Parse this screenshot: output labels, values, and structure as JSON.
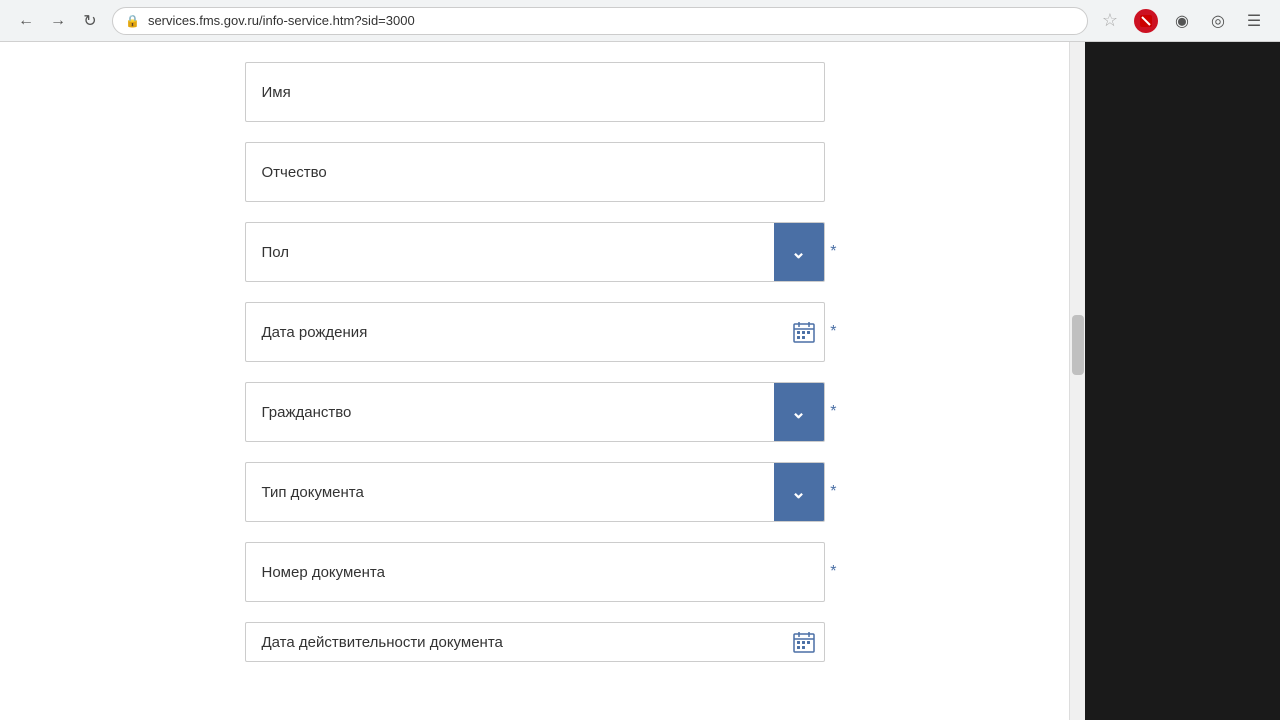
{
  "browser": {
    "url": "services.fms.gov.ru/info-service.htm?sid=3000",
    "back_disabled": false,
    "forward_disabled": false
  },
  "form": {
    "fields": [
      {
        "id": "imya",
        "type": "text",
        "placeholder": "Имя",
        "required": false
      },
      {
        "id": "otchestvo",
        "type": "text",
        "placeholder": "Отчество",
        "required": false
      },
      {
        "id": "pol",
        "type": "select",
        "placeholder": "Пол",
        "required": true
      },
      {
        "id": "data_rozhdeniya",
        "type": "date",
        "placeholder": "Дата рождения",
        "required": true
      },
      {
        "id": "grazhdanstvo",
        "type": "select",
        "placeholder": "Гражданство",
        "required": true
      },
      {
        "id": "tip_dokumenta",
        "type": "select",
        "placeholder": "Тип документа",
        "required": true
      },
      {
        "id": "nomer_dokumenta",
        "type": "text",
        "placeholder": "Номер документа",
        "required": true
      },
      {
        "id": "data_deystvitelnosti",
        "type": "date",
        "placeholder": "Дата действительности документа",
        "required": false
      }
    ]
  }
}
